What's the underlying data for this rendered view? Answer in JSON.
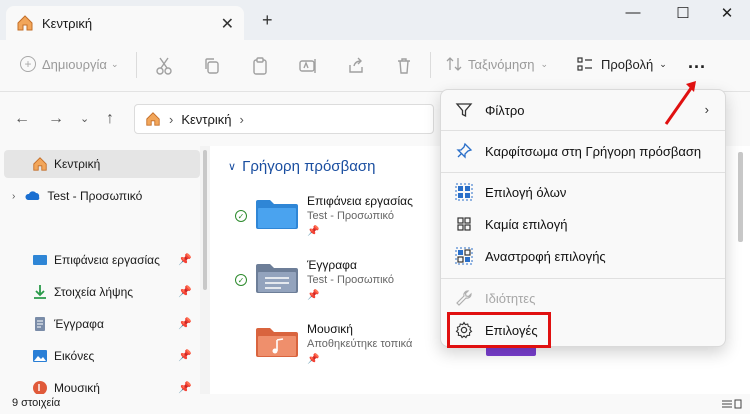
{
  "window": {
    "tab_title": "Κεντρική",
    "tab_close": "✕",
    "new_tab": "+",
    "minimize": "—",
    "maximize": "☐",
    "close": "✕"
  },
  "toolbar": {
    "new_label": "Δημιουργία",
    "sort_label": "Ταξινόμηση",
    "view_label": "Προβολή",
    "more_label": "..."
  },
  "address": {
    "location": "Κεντρική"
  },
  "sidebar": {
    "items": [
      {
        "label": "Κεντρική",
        "icon": "home-icon"
      },
      {
        "label": "Test - Προσωπικό",
        "icon": "onedrive-icon"
      },
      {
        "label": "Επιφάνεια εργασίας",
        "icon": "desktop-icon"
      },
      {
        "label": "Στοιχεία λήψης",
        "icon": "download-icon"
      },
      {
        "label": "Έγγραφα",
        "icon": "documents-icon"
      },
      {
        "label": "Εικόνες",
        "icon": "pictures-icon"
      },
      {
        "label": "Μουσική",
        "icon": "music-icon"
      }
    ]
  },
  "content": {
    "section_title": "Γρήγορη πρόσβαση",
    "files": [
      {
        "name": "Επιφάνεια εργασίας",
        "sub": "Test - Προσωπικό",
        "folder_color": "#2f86d6"
      },
      {
        "name": "Έγγραφα",
        "sub": "Test - Προσωπικό",
        "folder_color": "#7a8ca8"
      },
      {
        "name": "Μουσική",
        "sub": "Αποθηκεύτηκε τοπικά",
        "folder_color": "#e07a58"
      }
    ]
  },
  "menu": {
    "items": [
      {
        "label": "Φίλτρο",
        "icon": "filter-icon"
      },
      {
        "label": "Καρφίτσωμα στη Γρήγορη πρόσβαση",
        "icon": "pin-icon"
      },
      {
        "label": "Επιλογή όλων",
        "icon": "select-all-icon"
      },
      {
        "label": "Καμία επιλογή",
        "icon": "select-none-icon"
      },
      {
        "label": "Αναστροφή επιλογής",
        "icon": "invert-selection-icon"
      },
      {
        "label": "Ιδιότητες",
        "icon": "wrench-icon"
      },
      {
        "label": "Επιλογές",
        "icon": "gear-icon"
      }
    ]
  },
  "status": {
    "count": "9 στοιχεία"
  },
  "colors": {
    "accent": "#1a4ea0",
    "highlight": "#e01010"
  }
}
